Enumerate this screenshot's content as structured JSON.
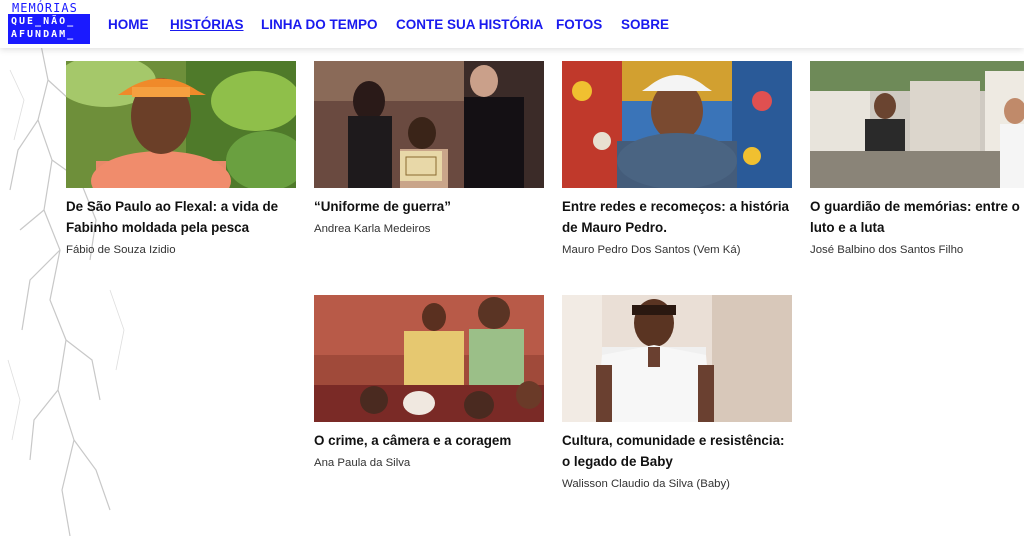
{
  "brand": {
    "top": "MEMÓRIAS",
    "line1": "QUE_NÃO_",
    "line2": "AFUNDAM_"
  },
  "nav": [
    {
      "label": "HOME",
      "active": false
    },
    {
      "label": "HISTÓRIAS",
      "active": true
    },
    {
      "label": "LINHA DO TEMPO",
      "active": false
    },
    {
      "label": "CONTE SUA HISTÓRIA",
      "active": false
    },
    {
      "label": "FOTOS",
      "active": false
    },
    {
      "label": "SOBRE",
      "active": false
    }
  ],
  "stories": [
    {
      "title": "De São Paulo ao Flexal: a vida de Fabinho moldada pela pesca",
      "author": "Fábio de Souza Izidio",
      "image": "man-orange-cap-portrait"
    },
    {
      "title": "“Uniforme de guerra”",
      "author": "Andrea Karla Medeiros",
      "image": "graduation-ceremony-photo"
    },
    {
      "title": "Entre redes e recomeços: a história de Mauro Pedro.",
      "author": "Mauro Pedro Dos Santos (Vem Ká)",
      "image": "man-white-cap-portrait"
    },
    {
      "title": "O guardião de memórias: entre o luto e a luta",
      "author": "José Balbino dos Santos Filho",
      "image": "cemetery-interview-photo"
    },
    {
      "title": "O crime, a câmera e a coragem",
      "author": "Ana Paula da Silva",
      "image": "family-birthday-photo"
    },
    {
      "title": "Cultura, comunidade e resistência: o legado de Baby",
      "author": "Walisson Claudio da Silva (Baby)",
      "image": "man-white-shirt-portrait"
    }
  ]
}
